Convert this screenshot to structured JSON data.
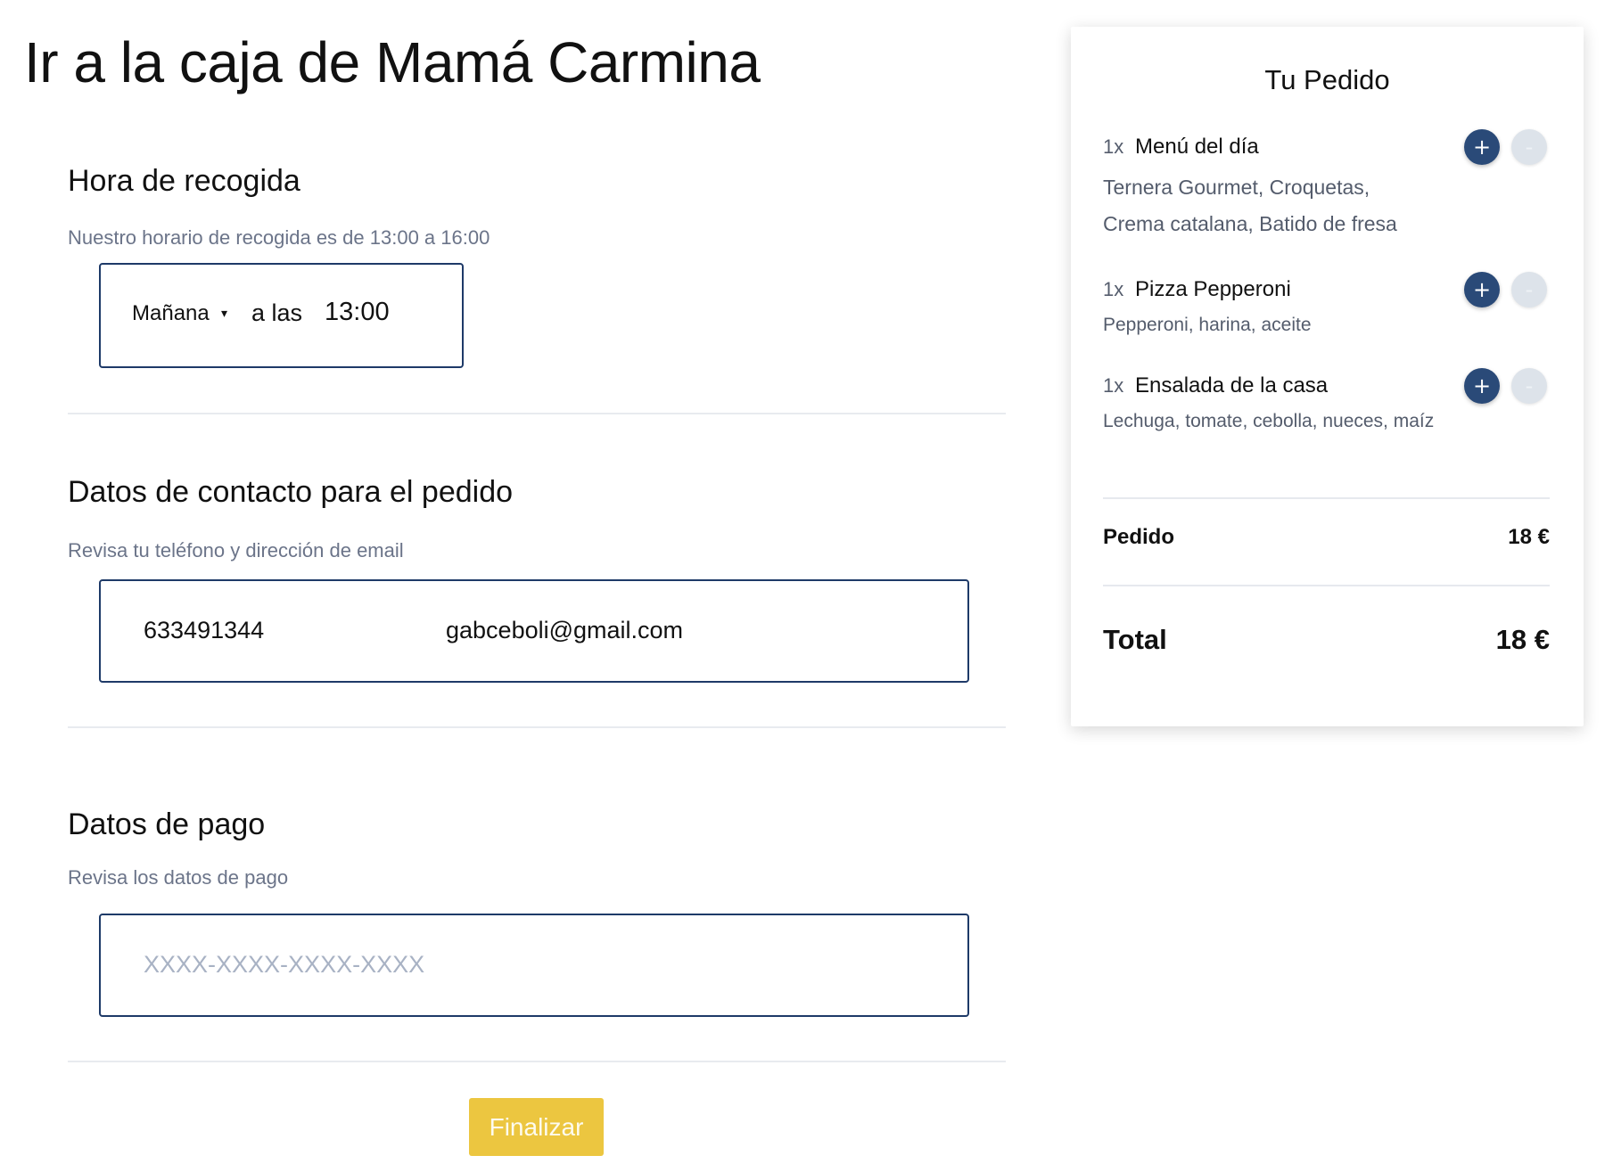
{
  "page": {
    "title": "Ir a la caja de Mamá Carmina"
  },
  "pickup": {
    "heading": "Hora de recogida",
    "subtitle": "Nuestro horario de recogida es de 13:00 a 16:00",
    "day_value": "Mañana",
    "caret_icon": "▾",
    "at_label": "a las",
    "time_value": "13:00"
  },
  "contact": {
    "heading": "Datos de contacto para el pedido",
    "subtitle": "Revisa tu teléfono y dirección de email",
    "phone_value": "633491344",
    "email_value": "gabceboli@gmail.com"
  },
  "payment": {
    "heading": "Datos de pago",
    "subtitle": "Revisa los datos de pago",
    "card_placeholder": "XXXX-XXXX-XXXX-XXXX",
    "card_value": ""
  },
  "submit": {
    "label": "Finalizar",
    "color": "#ecc640"
  },
  "order": {
    "title": "Tu Pedido",
    "plus_label": "+",
    "minus_label": "-",
    "items": [
      {
        "qty": "1x",
        "name": "Menú del día",
        "desc_lines": [
          "Ternera Gourmet, Croquetas,",
          "Crema catalana, Batido de fresa"
        ]
      },
      {
        "qty": "1x",
        "name": "Pizza Pepperoni",
        "desc_lines": [
          "Pepperoni, harina, aceite"
        ]
      },
      {
        "qty": "1x",
        "name": "Ensalada de la casa",
        "desc_lines": [
          "Lechuga, tomate, cebolla, nueces, maíz"
        ]
      }
    ],
    "subtotal_label": "Pedido",
    "subtotal_value": "18 €",
    "total_label": "Total",
    "total_value": "18 €"
  },
  "colors": {
    "accent": "#2a4a78",
    "border": "#1e3a68",
    "muted_text": "#6b7489"
  }
}
